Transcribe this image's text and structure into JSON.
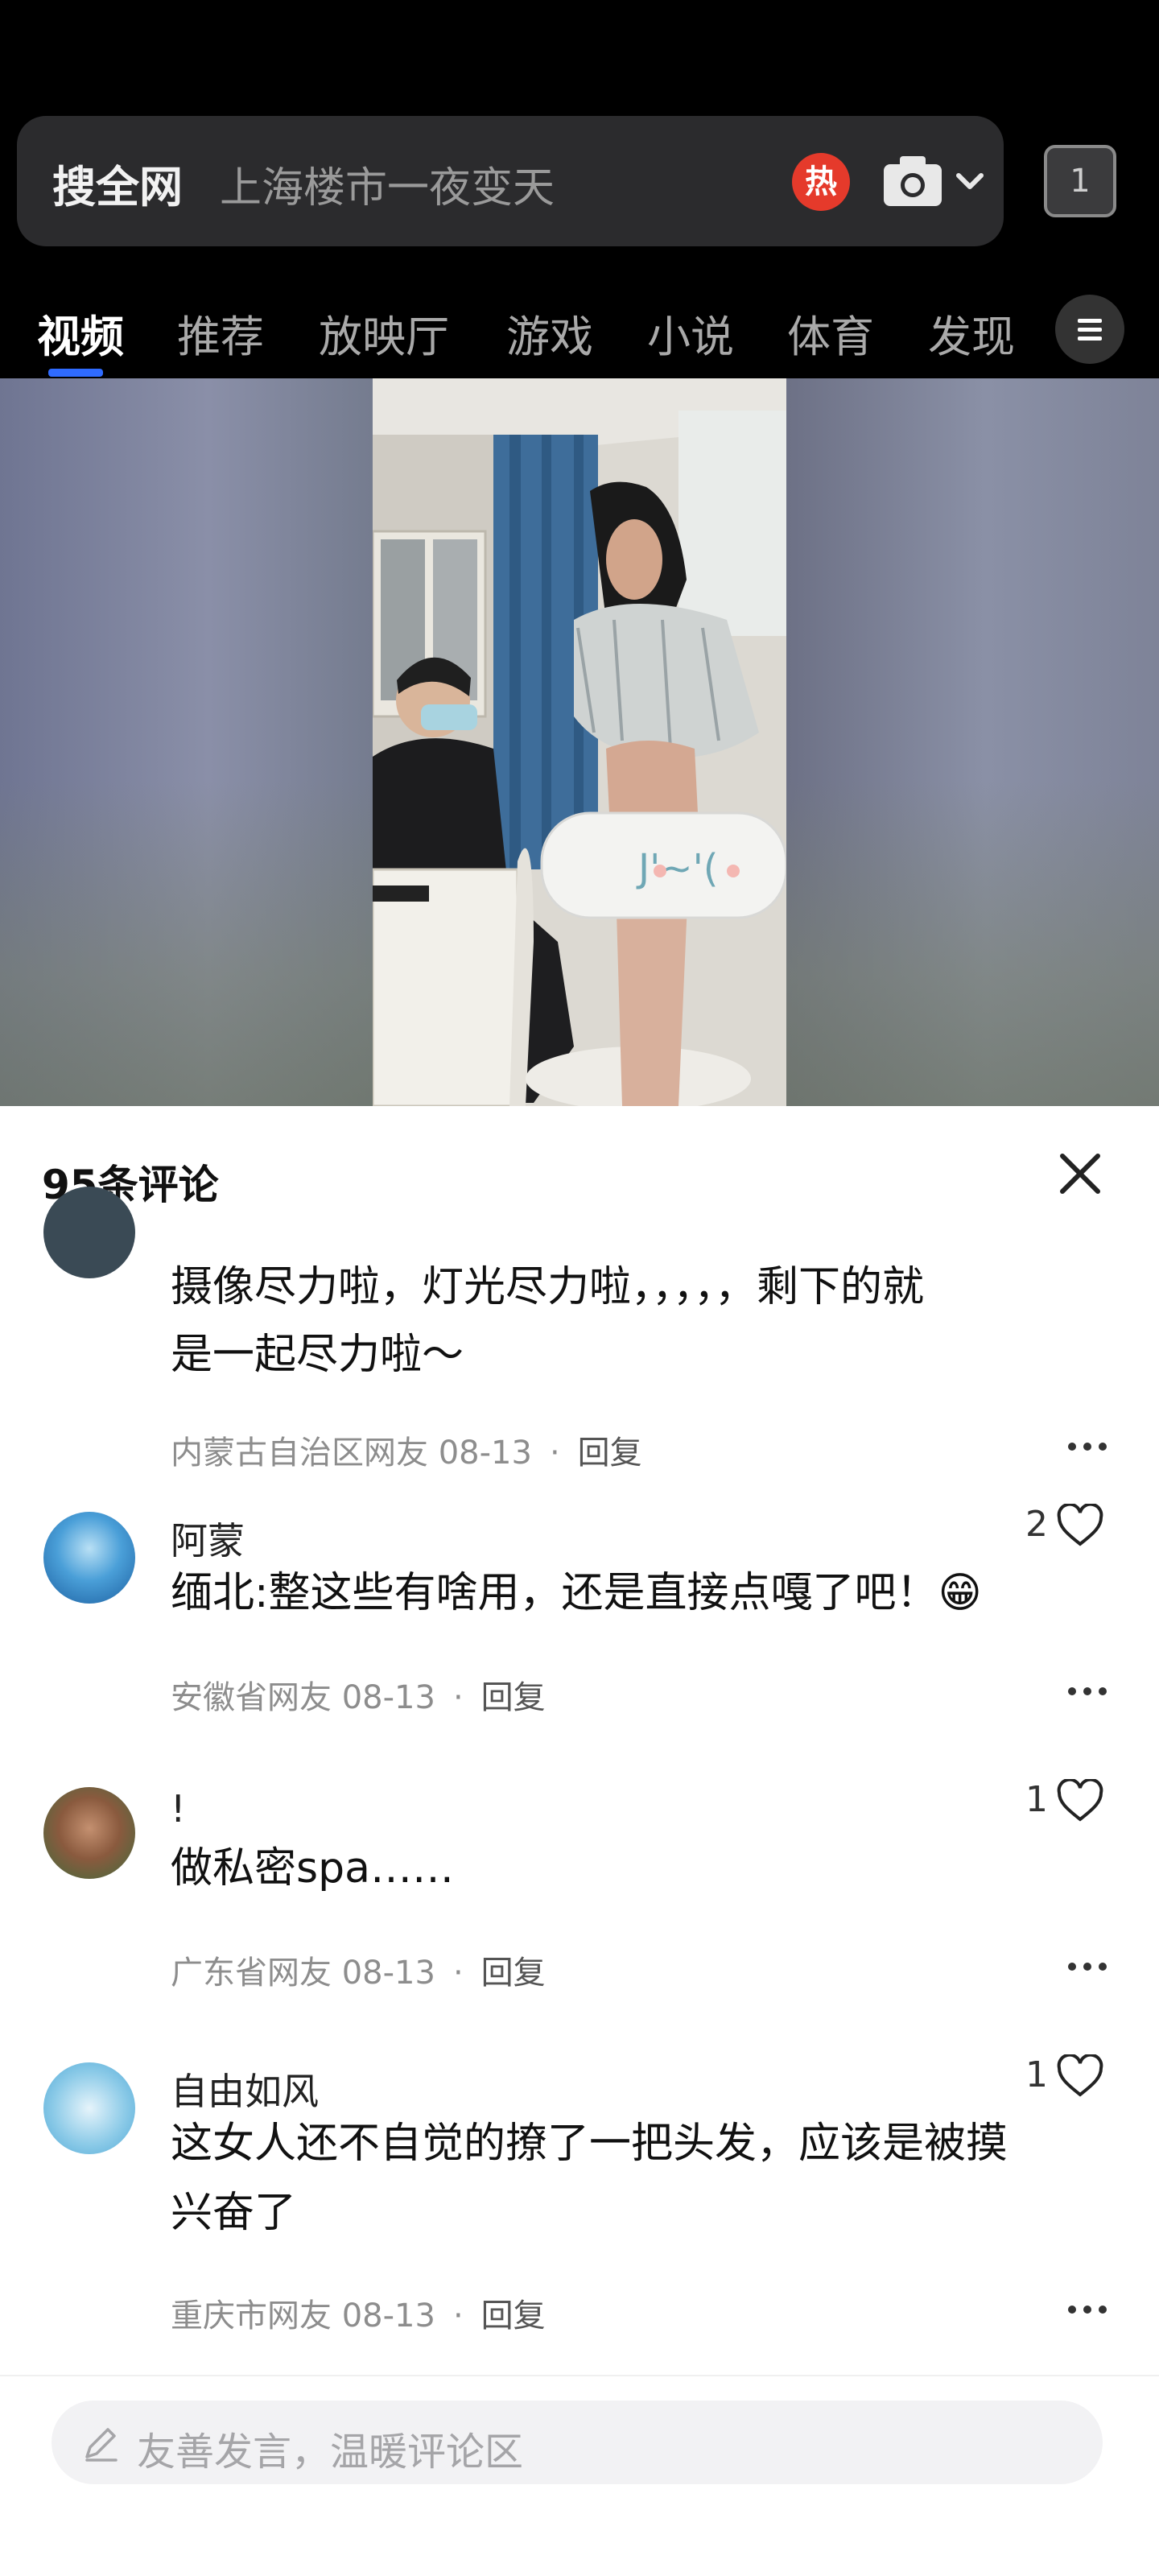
{
  "search": {
    "prefix": "搜全网",
    "query": "上海楼市一夜变天",
    "hot_badge": "热",
    "tab_count": "1"
  },
  "nav_tabs": [
    {
      "label": "视频",
      "active": true
    },
    {
      "label": "推荐",
      "active": false
    },
    {
      "label": "放映厅",
      "active": false
    },
    {
      "label": "游戏",
      "active": false
    },
    {
      "label": "小说",
      "active": false
    },
    {
      "label": "体育",
      "active": false
    },
    {
      "label": "发现",
      "active": false
    }
  ],
  "video": {
    "sticker_text": "J'~'("
  },
  "comments_panel": {
    "title": "95条评论",
    "comments": [
      {
        "name": "",
        "text_lines": [
          "摄像尽力啦，灯光尽力啦，，，，，剩下的就",
          "是一起尽力啦～"
        ],
        "region": "内蒙古自治区网友",
        "date": "08-13",
        "reply": "回复",
        "likes": ""
      },
      {
        "name": "阿蒙",
        "text_lines": [
          "缅北:整这些有啥用，还是直接点嘎了吧！😁"
        ],
        "region": "安徽省网友",
        "date": "08-13",
        "reply": "回复",
        "likes": "2"
      },
      {
        "name": "!",
        "text_lines": [
          "做私密spa……"
        ],
        "region": "广东省网友",
        "date": "08-13",
        "reply": "回复",
        "likes": "1"
      },
      {
        "name": "自由如风",
        "text_lines": [
          "这女人还不自觉的撩了一把头发，应该是被摸",
          "兴奋了"
        ],
        "region": "重庆市网友",
        "date": "08-13",
        "reply": "回复",
        "likes": "1"
      }
    ],
    "input_placeholder": "友善发言，温暖评论区",
    "dot_separator": "·"
  },
  "colors": {
    "accent": "#2f6bff",
    "hot": "#e53a2b",
    "background": "#000000",
    "panel": "#ffffff"
  }
}
